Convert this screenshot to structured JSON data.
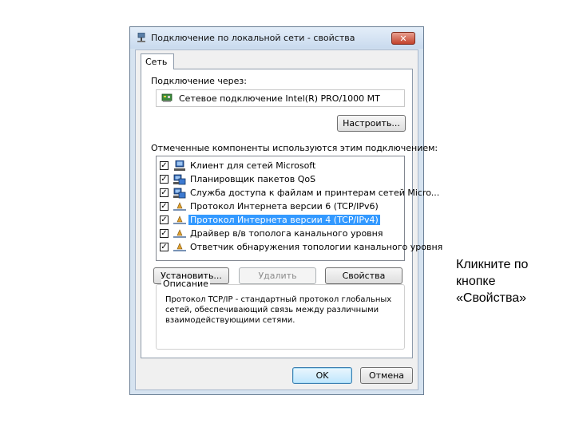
{
  "window": {
    "title": "Подключение по локальной сети - свойства",
    "close_label": "✕"
  },
  "tab": {
    "label": "Сеть"
  },
  "connect_via": {
    "label": "Подключение через:",
    "adapter": "Сетевое подключение Intel(R) PRO/1000 MT"
  },
  "configure_button": "Настроить...",
  "components": {
    "label": "Отмеченные компоненты используются этим подключением:",
    "items": [
      {
        "label": "Клиент для сетей Microsoft",
        "checked": true,
        "icon": "network-client-icon"
      },
      {
        "label": "Планировщик пакетов QoS",
        "checked": true,
        "icon": "network-service-icon"
      },
      {
        "label": "Служба доступа к файлам и принтерам сетей Micro...",
        "checked": true,
        "icon": "network-service-icon"
      },
      {
        "label": "Протокол Интернета версии 6 (TCP/IPv6)",
        "checked": true,
        "icon": "protocol-icon"
      },
      {
        "label": "Протокол Интернета версии 4 (TCP/IPv4)",
        "checked": true,
        "icon": "protocol-icon",
        "selected": true
      },
      {
        "label": "Драйвер в/в тополога канального уровня",
        "checked": true,
        "icon": "protocol-icon"
      },
      {
        "label": "Ответчик обнаружения топологии канального уровня",
        "checked": true,
        "icon": "protocol-icon"
      }
    ]
  },
  "actions": {
    "install": "Установить...",
    "remove": "Удалить",
    "properties": "Свойства"
  },
  "description": {
    "title": "Описание",
    "text": "Протокол TCP/IP - стандартный протокол глобальных сетей, обеспечивающий связь между различными взаимодействующими сетями."
  },
  "footer": {
    "ok": "OK",
    "cancel": "Отмена"
  },
  "caption": "Кликните по кнопке «Свойства»",
  "colors": {
    "selection": "#3399ff",
    "close_button": "#c3422c"
  }
}
